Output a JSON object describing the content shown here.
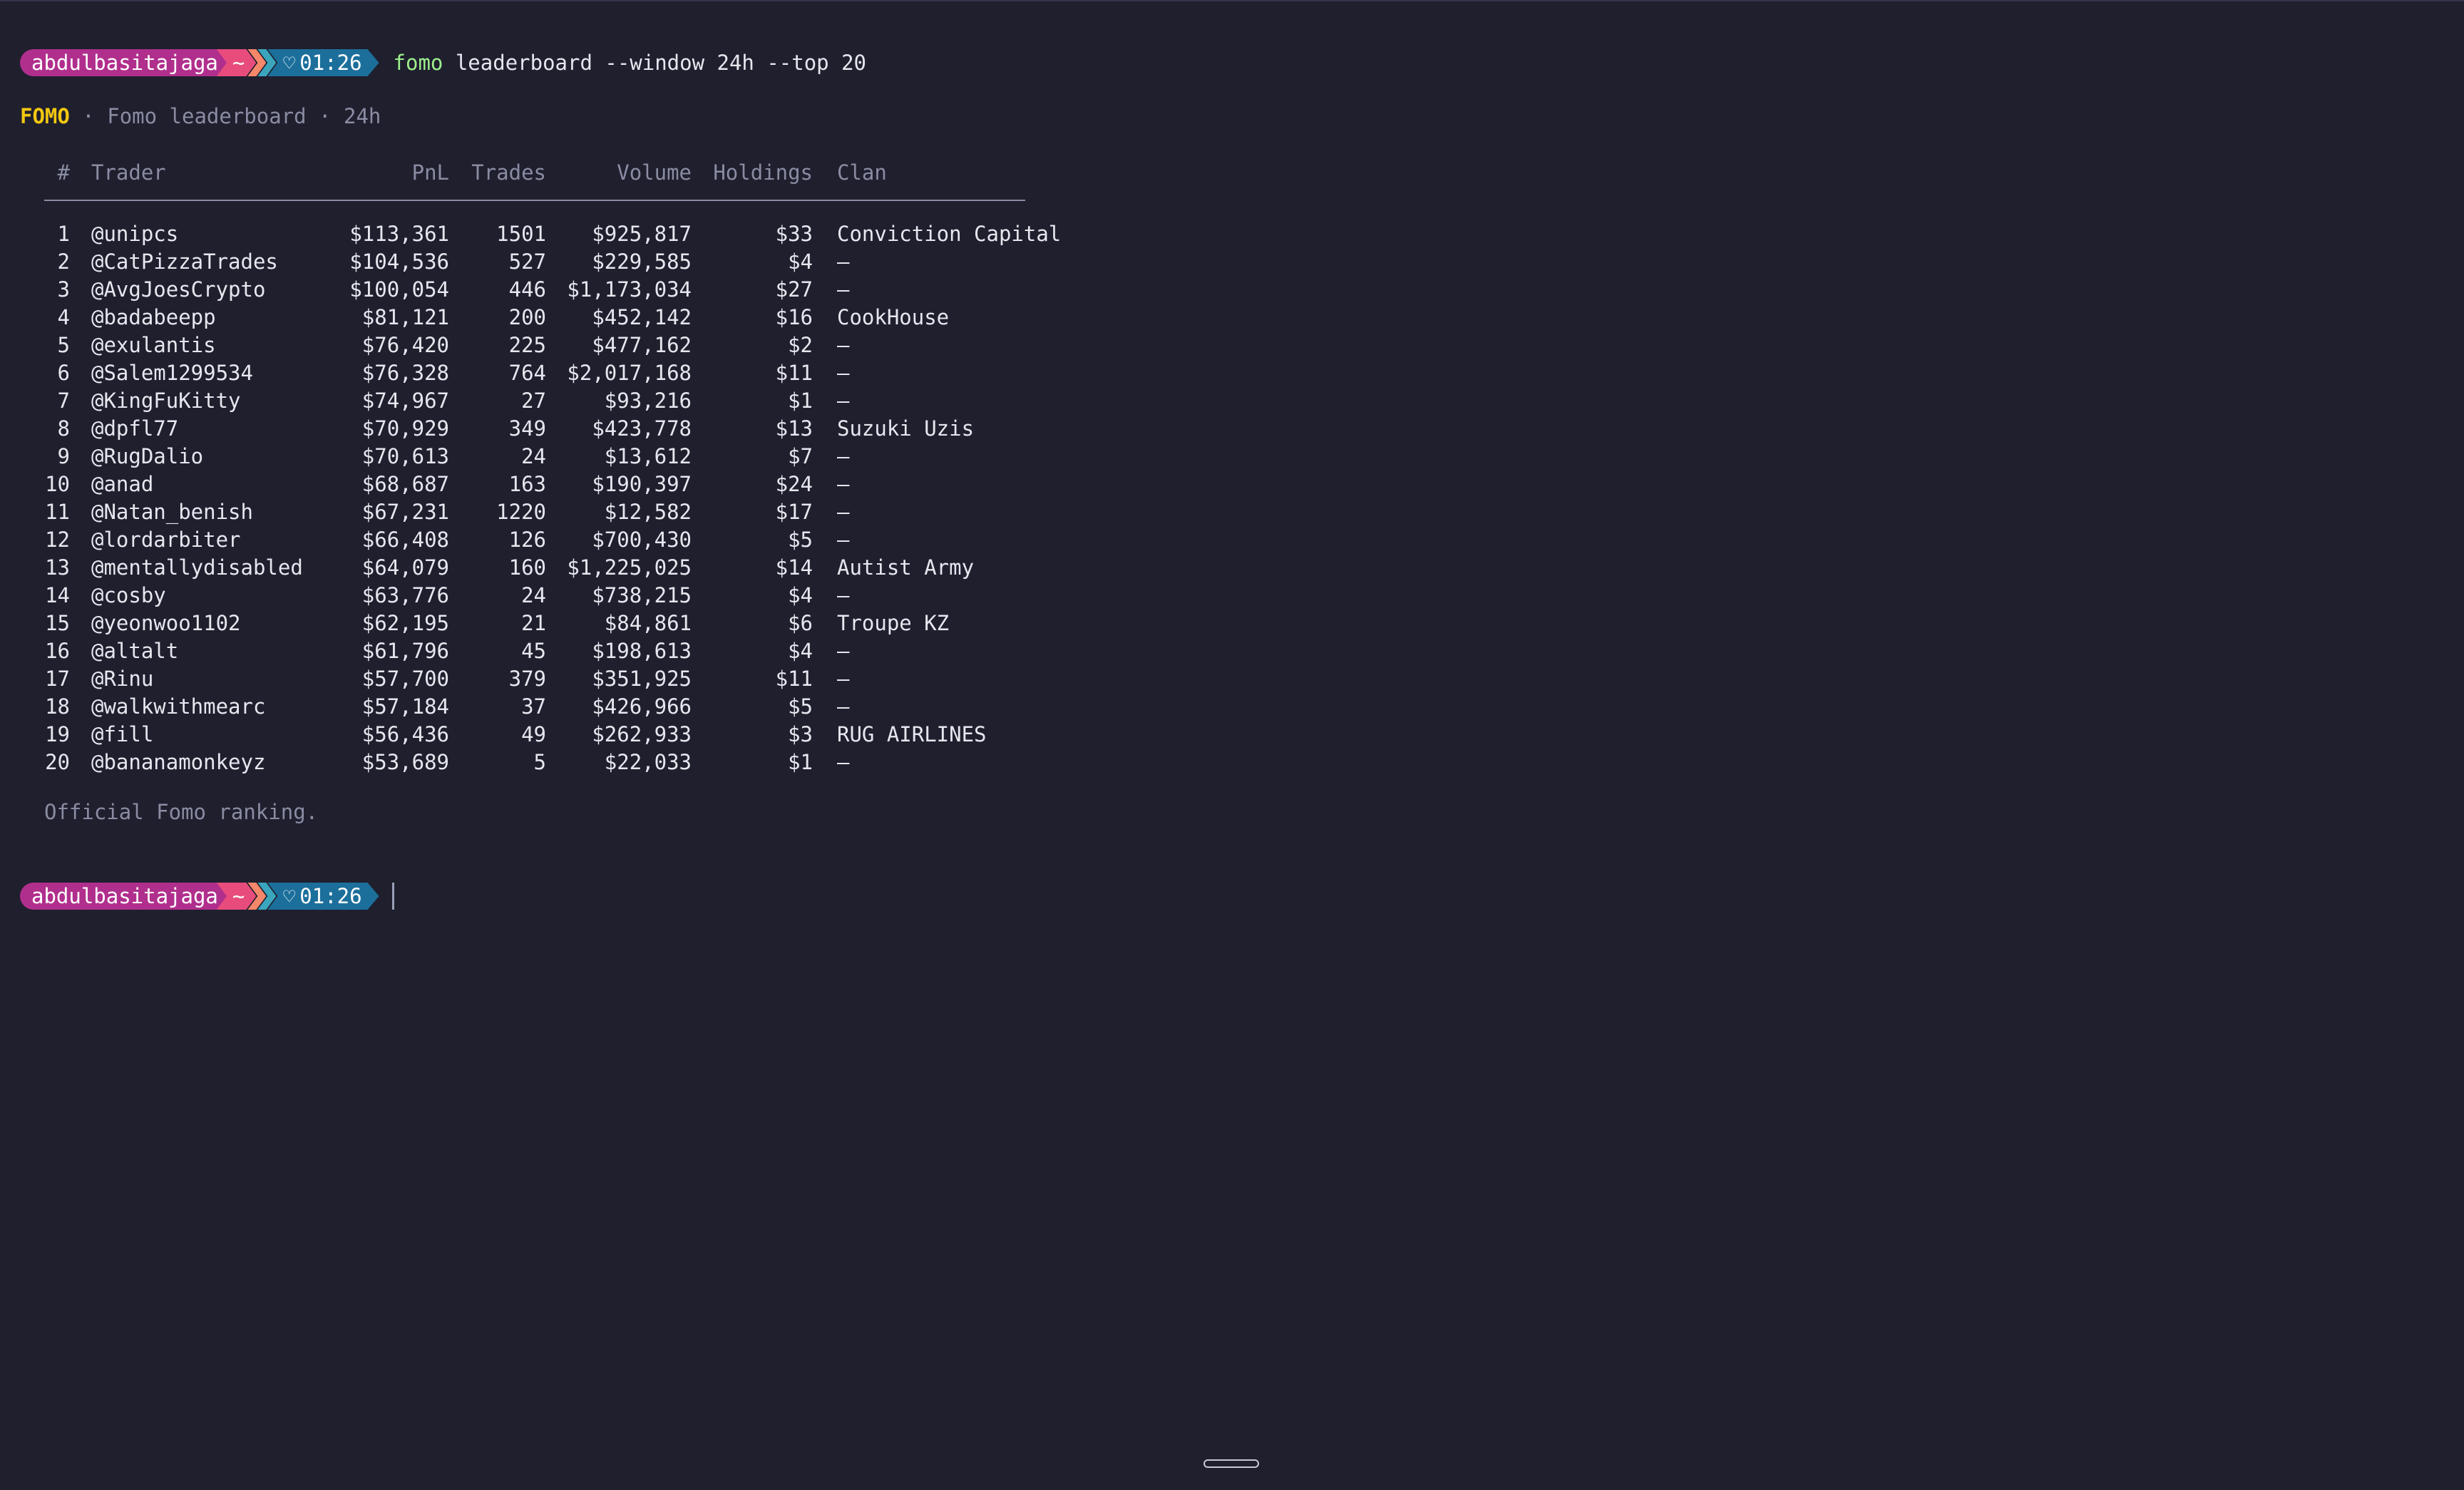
{
  "prompt": {
    "user": "abdulbasitajaga",
    "dir": "~",
    "time": "01:26",
    "command_bin": "fomo",
    "command_args": " leaderboard --window 24h --top 20"
  },
  "title": {
    "brand": "FOMO",
    "separator1": " · ",
    "name": "Fomo leaderboard",
    "separator2": " · ",
    "window": "24h"
  },
  "table": {
    "headers": {
      "rank": "#",
      "trader": "Trader",
      "pnl": "PnL",
      "trades": "Trades",
      "volume": "Volume",
      "holdings": "Holdings",
      "clan": "Clan"
    },
    "rows": [
      {
        "rank": "1",
        "trader": "@unipcs",
        "pnl": "$113,361",
        "trades": "1501",
        "volume": "$925,817",
        "holdings": "$33",
        "clan": "Conviction Capital"
      },
      {
        "rank": "2",
        "trader": "@CatPizzaTrades",
        "pnl": "$104,536",
        "trades": "527",
        "volume": "$229,585",
        "holdings": "$4",
        "clan": "–"
      },
      {
        "rank": "3",
        "trader": "@AvgJoesCrypto",
        "pnl": "$100,054",
        "trades": "446",
        "volume": "$1,173,034",
        "holdings": "$27",
        "clan": "–"
      },
      {
        "rank": "4",
        "trader": "@badabeepp",
        "pnl": "$81,121",
        "trades": "200",
        "volume": "$452,142",
        "holdings": "$16",
        "clan": "CookHouse"
      },
      {
        "rank": "5",
        "trader": "@exulantis",
        "pnl": "$76,420",
        "trades": "225",
        "volume": "$477,162",
        "holdings": "$2",
        "clan": "–"
      },
      {
        "rank": "6",
        "trader": "@Salem1299534",
        "pnl": "$76,328",
        "trades": "764",
        "volume": "$2,017,168",
        "holdings": "$11",
        "clan": "–"
      },
      {
        "rank": "7",
        "trader": "@KingFuKitty",
        "pnl": "$74,967",
        "trades": "27",
        "volume": "$93,216",
        "holdings": "$1",
        "clan": "–"
      },
      {
        "rank": "8",
        "trader": "@dpfl77",
        "pnl": "$70,929",
        "trades": "349",
        "volume": "$423,778",
        "holdings": "$13",
        "clan": "Suzuki Uzis"
      },
      {
        "rank": "9",
        "trader": "@RugDalio",
        "pnl": "$70,613",
        "trades": "24",
        "volume": "$13,612",
        "holdings": "$7",
        "clan": "–"
      },
      {
        "rank": "10",
        "trader": "@anad",
        "pnl": "$68,687",
        "trades": "163",
        "volume": "$190,397",
        "holdings": "$24",
        "clan": "–"
      },
      {
        "rank": "11",
        "trader": "@Natan_benish",
        "pnl": "$67,231",
        "trades": "1220",
        "volume": "$12,582",
        "holdings": "$17",
        "clan": "–"
      },
      {
        "rank": "12",
        "trader": "@lordarbiter",
        "pnl": "$66,408",
        "trades": "126",
        "volume": "$700,430",
        "holdings": "$5",
        "clan": "–"
      },
      {
        "rank": "13",
        "trader": "@mentallydisabled",
        "pnl": "$64,079",
        "trades": "160",
        "volume": "$1,225,025",
        "holdings": "$14",
        "clan": "Autist Army"
      },
      {
        "rank": "14",
        "trader": "@cosby",
        "pnl": "$63,776",
        "trades": "24",
        "volume": "$738,215",
        "holdings": "$4",
        "clan": "–"
      },
      {
        "rank": "15",
        "trader": "@yeonwoo1102",
        "pnl": "$62,195",
        "trades": "21",
        "volume": "$84,861",
        "holdings": "$6",
        "clan": "Troupe KZ"
      },
      {
        "rank": "16",
        "trader": "@altalt",
        "pnl": "$61,796",
        "trades": "45",
        "volume": "$198,613",
        "holdings": "$4",
        "clan": "–"
      },
      {
        "rank": "17",
        "trader": "@Rinu",
        "pnl": "$57,700",
        "trades": "379",
        "volume": "$351,925",
        "holdings": "$11",
        "clan": "–"
      },
      {
        "rank": "18",
        "trader": "@walkwithmearc",
        "pnl": "$57,184",
        "trades": "37",
        "volume": "$426,966",
        "holdings": "$5",
        "clan": "–"
      },
      {
        "rank": "19",
        "trader": "@fill",
        "pnl": "$56,436",
        "trades": "49",
        "volume": "$262,933",
        "holdings": "$3",
        "clan": "RUG AIRLINES"
      },
      {
        "rank": "20",
        "trader": "@bananamonkeyz",
        "pnl": "$53,689",
        "trades": "5",
        "volume": "$22,033",
        "holdings": "$1",
        "clan": "–"
      }
    ]
  },
  "footer": "Official Fomo ranking.",
  "colors": {
    "background": "#1f1f2e",
    "brand": "#f2c811",
    "command": "#9ef08d",
    "segment_user": "#b02f8d",
    "segment_dir": "#e74c7c",
    "segment_time": "#1c6f9b"
  },
  "icons": {
    "time_segment": "heart-icon"
  }
}
